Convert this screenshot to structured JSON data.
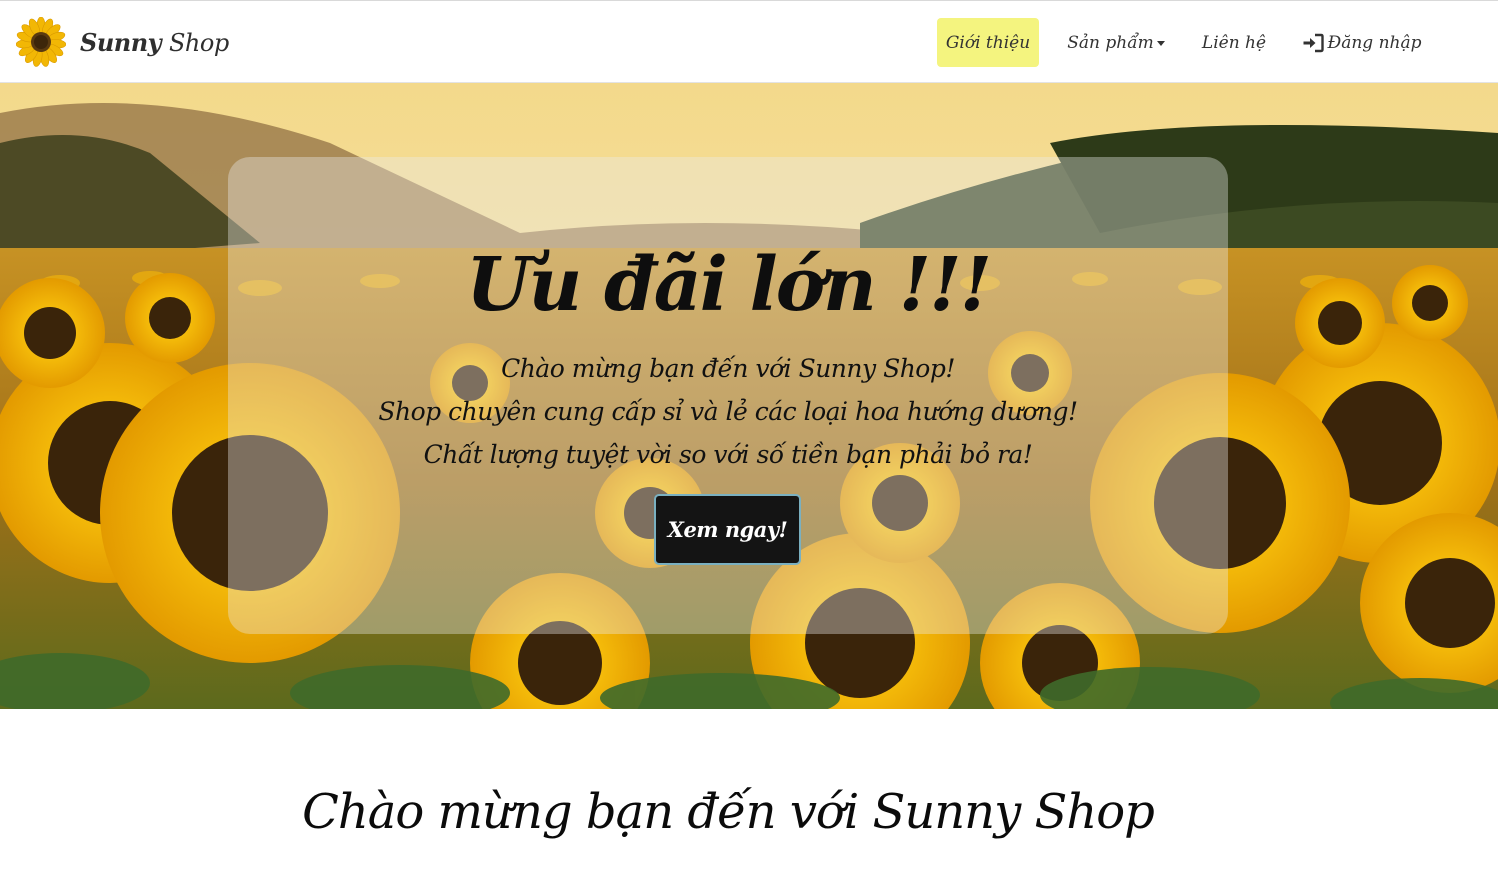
{
  "navbar": {
    "brand": {
      "name_bold": "Sunny",
      "name_light": "Shop",
      "logo_icon": "sunflower-icon"
    },
    "items": [
      {
        "label": "Giới thiệu",
        "active": true
      },
      {
        "label": "Sản phẩm",
        "dropdown": true
      },
      {
        "label": "Liên hệ"
      },
      {
        "label": "Đăng nhập",
        "icon": "login-icon"
      }
    ],
    "active_color": "#f4f47f"
  },
  "hero": {
    "title": "Ưu đãi lớn !!!",
    "lines": [
      "Chào mừng bạn đến với Sunny Shop!",
      "Shop chuyên cung cấp sỉ và lẻ các loại hoa hướng dương!",
      "Chất lượng tuyệt vời so với số tiền bạn phải bỏ ra!"
    ],
    "button_label": "Xem ngay!",
    "background": "sunflower-field-photo"
  },
  "welcome": {
    "title": "Chào mừng bạn đến với Sunny Shop"
  }
}
